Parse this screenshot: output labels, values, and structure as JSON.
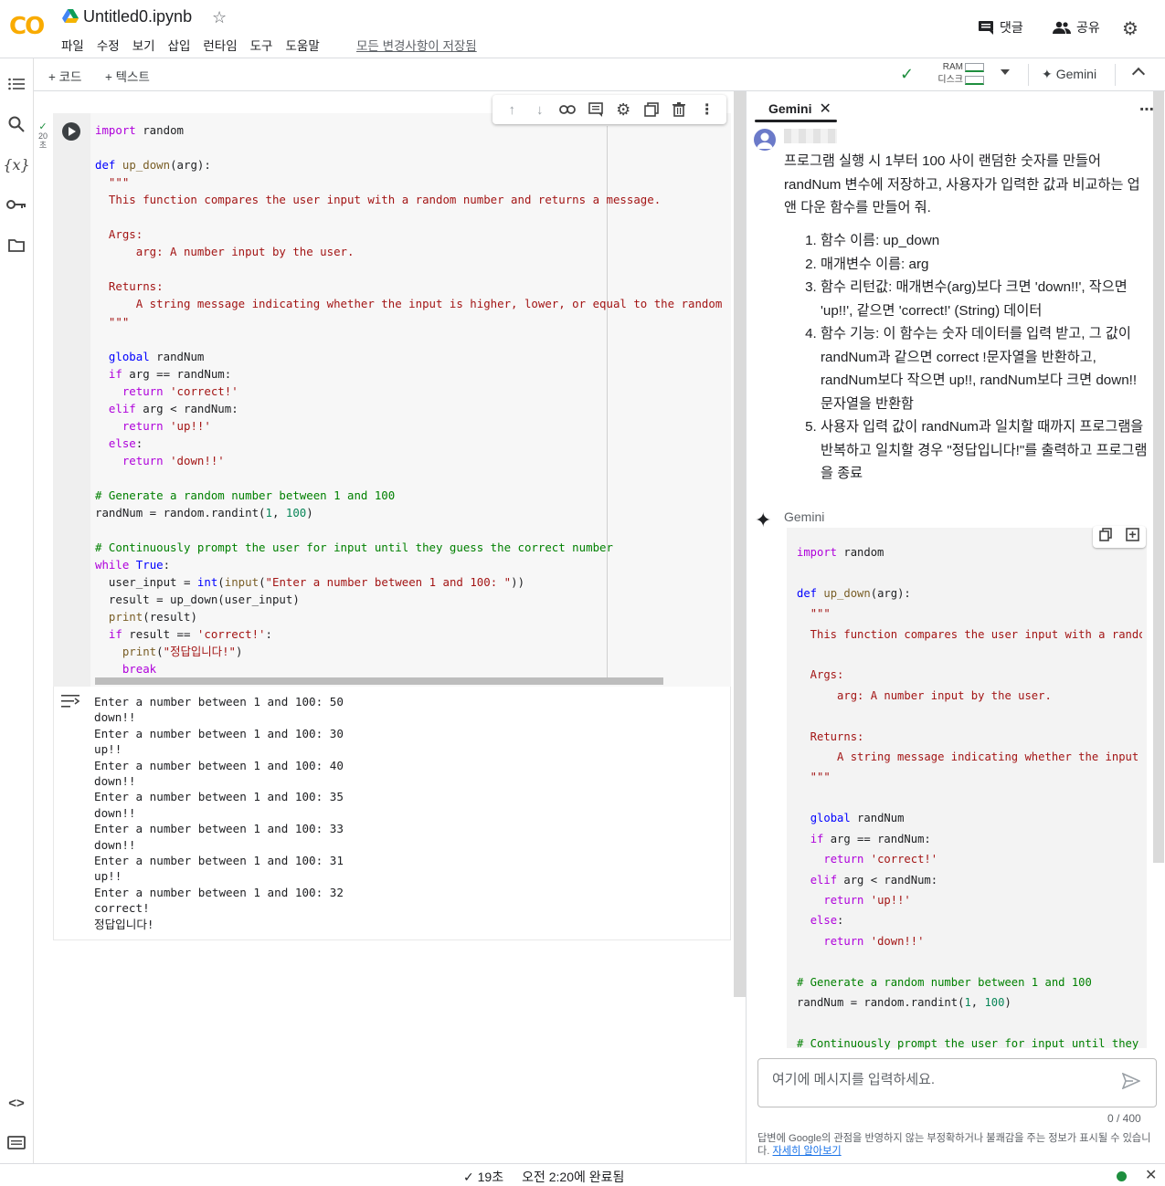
{
  "header": {
    "logo": "CO",
    "notebook_title": "Untitled0.ipynb",
    "menu": [
      "파일",
      "수정",
      "보기",
      "삽입",
      "런타임",
      "도구",
      "도움말"
    ],
    "saved_status": "모든 변경사항이 저장됨",
    "comment_label": "댓글",
    "share_label": "공유"
  },
  "toolbar": {
    "add_code": "+ 코드",
    "add_text": "+ 텍스트",
    "ram_label": "RAM",
    "disk_label": "디스크",
    "gemini_label": "Gemini"
  },
  "cell": {
    "exec_time": "20\n초"
  },
  "output": {
    "lines": "Enter a number between 1 and 100: 50\ndown!!\nEnter a number between 1 and 100: 30\nup!!\nEnter a number between 1 and 100: 40\ndown!!\nEnter a number between 1 and 100: 35\ndown!!\nEnter a number between 1 and 100: 33\ndown!!\nEnter a number between 1 and 100: 31\nup!!\nEnter a number between 1 and 100: 32\ncorrect!\n정답입니다!"
  },
  "gemini": {
    "tab_label": "Gemini",
    "user_message": "프로그램 실행 시 1부터 100 사이 랜덤한 숫자를 만들어 randNum 변수에 저장하고, 사용자가 입력한 값과 비교하는 업 앤 다운 함수를 만들어 줘.",
    "user_list": [
      "함수 이름: up_down",
      "매개변수 이름: arg",
      "함수 리턴값: 매개변수(arg)보다 크면 'down!!', 작으면 'up!!', 같으면 'correct!' (String) 데이터",
      "함수 기능: 이 함수는 숫자 데이터를 입력 받고, 그 값이 randNum과 같으면 correct !문자열을 반환하고, randNum보다 작으면 up!!, randNum보다 크면 down!! 문자열을 반환함",
      "사용자 입력 값이 randNum과 일치할 때까지 프로그램을 반복하고 일치할 경우 \"정답입니다!\"를 출력하고 프로그램을 종료"
    ],
    "response_label": "Gemini",
    "input_placeholder": "여기에 메시지를 입력하세요.",
    "char_count": "0 / 400",
    "disclaimer": "답변에 Google의 관점을 반영하지 않는 부정확하거나 불쾌감을 주는 정보가 표시될 수 있습니다.",
    "learn_more": "자세히 알아보기"
  },
  "statusbar": {
    "duration": "✓ 19초",
    "completed": "오전 2:20에 완료됨"
  },
  "colors": {
    "keyword": "#0000ff",
    "control": "#af00db",
    "string": "#a31515",
    "comment": "#008000",
    "number": "#098658",
    "status_ok": "#1e8e3e"
  }
}
